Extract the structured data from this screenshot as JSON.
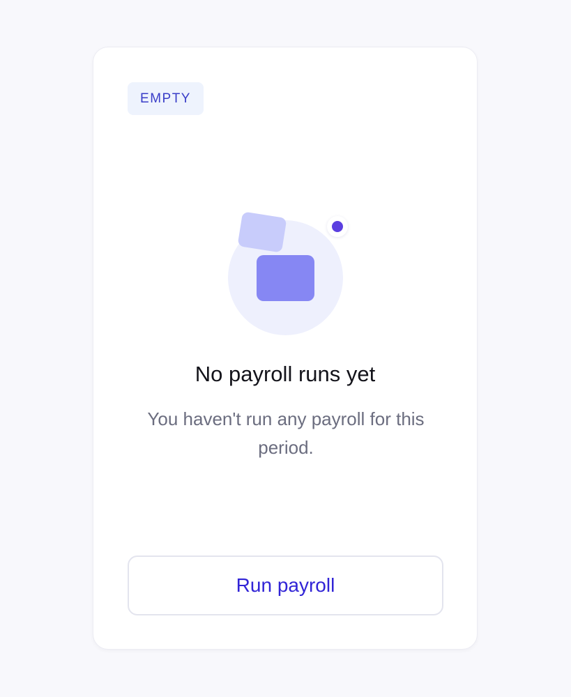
{
  "badge": {
    "label": "EMPTY"
  },
  "empty_state": {
    "title": "No payroll runs yet",
    "description": "You haven't run any payroll for this period.",
    "illustration_icon": "payroll-cards-icon"
  },
  "actions": {
    "primary_label": "Run payroll"
  },
  "colors": {
    "page_background": "#f8f8fc",
    "card_background": "#ffffff",
    "badge_background": "#eef3fd",
    "badge_text": "#3a3ec8",
    "accent_dot": "#5b3fe0",
    "illustration_primary": "#8687f3",
    "illustration_secondary": "#c8ccfb",
    "button_text": "#3124d6"
  }
}
